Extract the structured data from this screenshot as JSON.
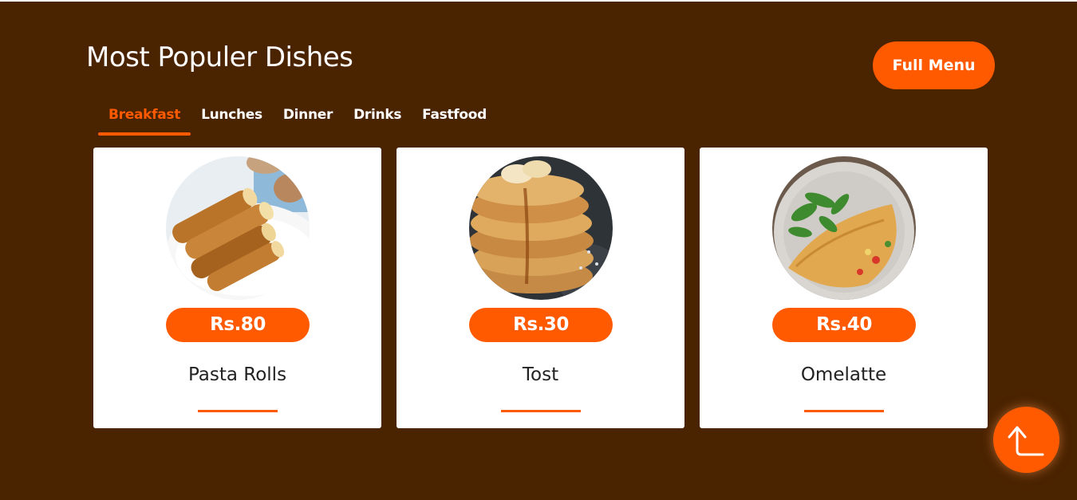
{
  "section": {
    "title": "Most Populer Dishes",
    "full_menu_label": "Full Menu"
  },
  "tabs": [
    {
      "label": "Breakfast",
      "active": true
    },
    {
      "label": "Lunches",
      "active": false
    },
    {
      "label": "Dinner",
      "active": false
    },
    {
      "label": "Drinks",
      "active": false
    },
    {
      "label": "Fastfood",
      "active": false
    }
  ],
  "dishes": [
    {
      "name": "Pasta Rolls",
      "price": "Rs.80",
      "image": "pasta-rolls-photo"
    },
    {
      "name": "Tost",
      "price": "Rs.30",
      "image": "pancake-stack-photo"
    },
    {
      "name": "Omelatte",
      "price": "Rs.40",
      "image": "omelette-plate-photo"
    }
  ],
  "back_to_top": {
    "icon": "arrow-up-corner-icon"
  },
  "colors": {
    "background": "#4a2300",
    "accent": "#ff5a00",
    "card": "#ffffff",
    "text_dark": "#222222"
  }
}
